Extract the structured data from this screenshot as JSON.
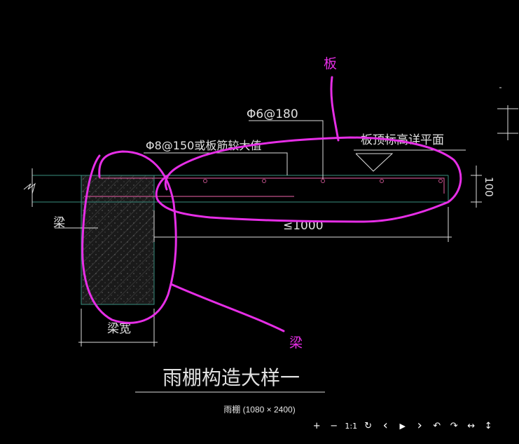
{
  "drawing": {
    "title": "雨棚构造大样一",
    "labels": {
      "rebar_top": "Φ6@180",
      "rebar_bend": "Φ8@150或板筋较大值",
      "slab_top_note": "板顶标高详平面",
      "thickness": "100",
      "cantilever_length": "≤1000",
      "beam": "梁",
      "beam_width": "梁宽"
    },
    "annotations": {
      "slab": "板",
      "beam": "梁"
    }
  },
  "viewer": {
    "caption": "雨棚 (1080 × 2400)",
    "controls": [
      {
        "name": "zoom-in",
        "glyph": "+"
      },
      {
        "name": "zoom-out",
        "glyph": "−"
      },
      {
        "name": "actual-size",
        "glyph": "1:1"
      },
      {
        "name": "reset",
        "glyph": "↻"
      },
      {
        "name": "previous",
        "glyph": "‹"
      },
      {
        "name": "play",
        "glyph": "▶"
      },
      {
        "name": "next",
        "glyph": "›"
      },
      {
        "name": "rotate-left",
        "glyph": "↶"
      },
      {
        "name": "rotate-right",
        "glyph": "↷"
      },
      {
        "name": "flip-horizontal",
        "glyph": "↔"
      },
      {
        "name": "flip-vertical",
        "glyph": "↕"
      }
    ]
  },
  "colors": {
    "background": "#000000",
    "lines": "#ffffff",
    "slab_outline": "#3a8f80",
    "rebar": "#c0508a",
    "annotation": "#e62ee6"
  }
}
